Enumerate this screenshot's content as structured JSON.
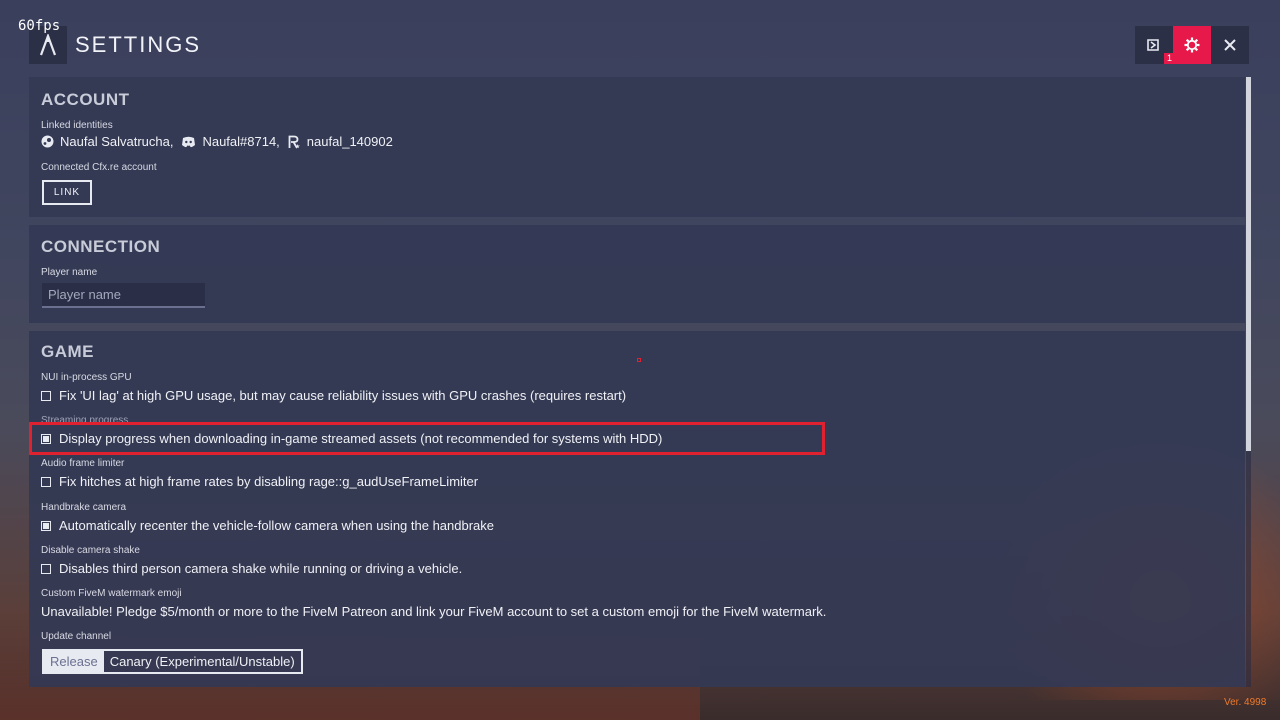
{
  "fps": "60fps",
  "app": {
    "title": "SETTINGS"
  },
  "window_buttons": {
    "notification_count": "1"
  },
  "account": {
    "title": "ACCOUNT",
    "linked_label": "Linked identities",
    "identities": [
      {
        "icon": "steam-icon",
        "name": "Naufal Salvatrucha,"
      },
      {
        "icon": "discord-icon",
        "name": "Naufal#8714,"
      },
      {
        "icon": "rockstar-icon",
        "name": "naufal_140902"
      }
    ],
    "cfx_label": "Connected Cfx.re account",
    "link_button": "LINK"
  },
  "connection": {
    "title": "CONNECTION",
    "player_name_label": "Player name",
    "player_name_placeholder": "Player name",
    "player_name_value": ""
  },
  "game": {
    "title": "GAME",
    "options": [
      {
        "label": "NUI in-process GPU",
        "text": "Fix 'UI lag' at high GPU usage, but may cause reliability issues with GPU crashes (requires restart)",
        "checked": false
      },
      {
        "label": "Streaming progress",
        "text": "Display progress when downloading in-game streamed assets (not recommended for systems with HDD)",
        "checked": true
      },
      {
        "label": "Audio frame limiter",
        "text": "Fix hitches at high frame rates by disabling rage::g_audUseFrameLimiter",
        "checked": false
      },
      {
        "label": "Handbrake camera",
        "text": "Automatically recenter the vehicle-follow camera when using the handbrake",
        "checked": true
      },
      {
        "label": "Disable camera shake",
        "text": "Disables third person camera shake while running or driving a vehicle.",
        "checked": false
      }
    ],
    "emoji_label": "Custom FiveM watermark emoji",
    "emoji_text": "Unavailable! Pledge $5/month or more to the FiveM Patreon and link your FiveM account to set a custom emoji for the FiveM watermark.",
    "update_label": "Update channel",
    "update_options": [
      "Release",
      "Canary (Experimental/Unstable)"
    ],
    "update_selected": "Release"
  },
  "version": "Ver. 4998",
  "colors": {
    "accent": "#e7194b",
    "highlight": "#e0212f",
    "version": "#f07a2a"
  }
}
